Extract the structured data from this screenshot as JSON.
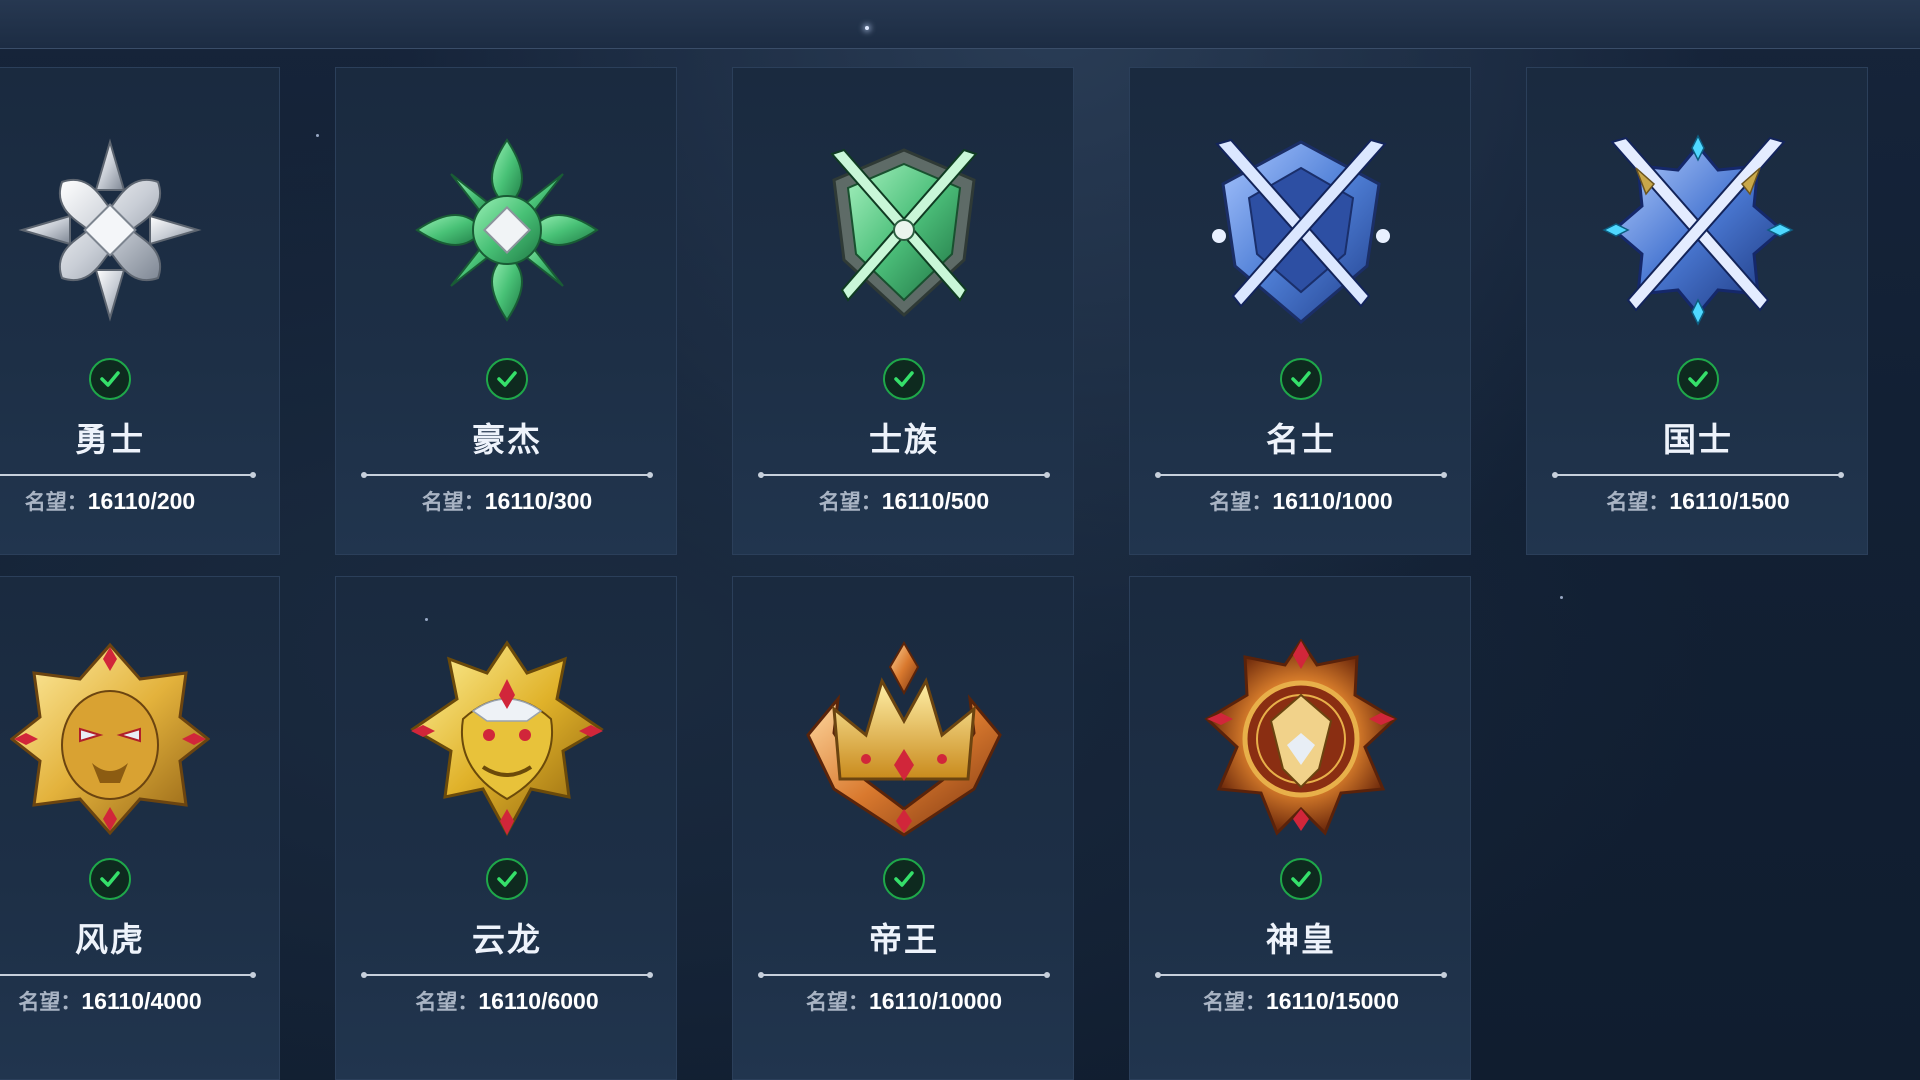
{
  "fame_label": "名望：",
  "ranks": [
    {
      "name": "勇士",
      "fame": "16110/200",
      "completed": true,
      "emblem": "silver-star-emblem-icon"
    },
    {
      "name": "豪杰",
      "fame": "16110/300",
      "completed": true,
      "emblem": "green-star-emblem-icon"
    },
    {
      "name": "士族",
      "fame": "16110/500",
      "completed": true,
      "emblem": "green-swords-shield-emblem-icon"
    },
    {
      "name": "名士",
      "fame": "16110/1000",
      "completed": true,
      "emblem": "blue-swords-shield-emblem-icon"
    },
    {
      "name": "国士",
      "fame": "16110/1500",
      "completed": true,
      "emblem": "blue-gem-swords-emblem-icon"
    },
    {
      "name": "风虎",
      "fame": "16110/4000",
      "completed": true,
      "emblem": "gold-tiger-emblem-icon"
    },
    {
      "name": "云龙",
      "fame": "16110/6000",
      "completed": true,
      "emblem": "gold-dragon-emblem-icon"
    },
    {
      "name": "帝王",
      "fame": "16110/10000",
      "completed": true,
      "emblem": "gold-crown-emblem-icon"
    },
    {
      "name": "神皇",
      "fame": "16110/15000",
      "completed": true,
      "emblem": "gold-sun-emblem-icon"
    }
  ],
  "colors": {
    "check": "#1fa84a",
    "silver": "#d9dde3",
    "green": "#4fc27a",
    "blue": "#4f7fd6",
    "gold": "#e3b23c",
    "orange": "#d9792e"
  }
}
